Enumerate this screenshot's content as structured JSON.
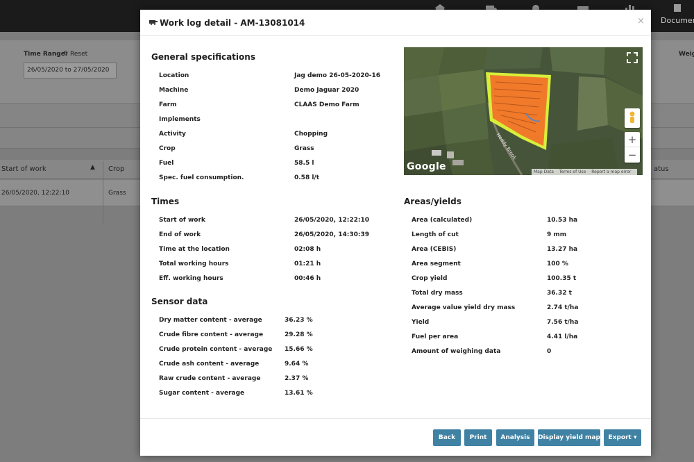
{
  "app": {
    "documents_label": "Document",
    "time_range_label": "Time Range:",
    "reset_label": "Reset",
    "date_range_value": "26/05/2020 to 27/05/2020",
    "weight_label": "Weig",
    "table": {
      "columns": {
        "start_of_work": "Start of work",
        "crop": "Crop",
        "status": "atus"
      },
      "row": {
        "start_of_work": "26/05/2020, 12:22:10",
        "crop": "Grass"
      }
    }
  },
  "modal": {
    "title": "Work log detail - AM-13081014",
    "close_label": "×",
    "general": {
      "heading": "General specifications",
      "rows": [
        {
          "label": "Location",
          "value": "Jag demo 26-05-2020-16"
        },
        {
          "label": "Machine",
          "value": "Demo Jaguar 2020"
        },
        {
          "label": "Farm",
          "value": "CLAAS Demo Farm"
        },
        {
          "label": "Implements",
          "value": ""
        },
        {
          "label": "Activity",
          "value": "Chopping"
        },
        {
          "label": "Crop",
          "value": "Grass"
        },
        {
          "label": "Fuel",
          "value": "58.5 l"
        },
        {
          "label": "Spec. fuel consumption.",
          "value": "0.58 l/t"
        }
      ]
    },
    "times": {
      "heading": "Times",
      "rows": [
        {
          "label": "Start of work",
          "value": "26/05/2020, 12:22:10"
        },
        {
          "label": "End of work",
          "value": "26/05/2020, 14:30:39"
        },
        {
          "label": "Time at the location",
          "value": "02:08 h"
        },
        {
          "label": "Total working hours",
          "value": "01:21 h"
        },
        {
          "label": "Eff. working hours",
          "value": "00:46 h"
        }
      ]
    },
    "sensor": {
      "heading": "Sensor data",
      "rows": [
        {
          "label": "Dry matter content - average",
          "value": "36.23 %"
        },
        {
          "label": "Crude fibre content - average",
          "value": "29.28 %"
        },
        {
          "label": "Crude protein content - average",
          "value": "15.66 %"
        },
        {
          "label": "Crude ash content - average",
          "value": "9.64 %"
        },
        {
          "label": "Raw crude content - average",
          "value": "2.37 %"
        },
        {
          "label": "Sugar content - average",
          "value": "13.61 %"
        }
      ]
    },
    "areas": {
      "heading": "Areas/yields",
      "rows": [
        {
          "label": "Area (calculated)",
          "value": "10.53 ha"
        },
        {
          "label": "Length of cut",
          "value": "9 mm"
        },
        {
          "label": "Area (CEBIS)",
          "value": "13.27 ha"
        },
        {
          "label": "Area segment",
          "value": "100 %"
        },
        {
          "label": "Crop yield",
          "value": "100.35 t"
        },
        {
          "label": "Total dry mass",
          "value": "36.32 t"
        },
        {
          "label": "Average value yield dry mass",
          "value": "2.74 t/ha"
        },
        {
          "label": "Yield",
          "value": "7.56 t/ha"
        },
        {
          "label": "Fuel per area",
          "value": "4.41 l/ha"
        },
        {
          "label": "Amount of weighing data",
          "value": "0"
        }
      ]
    },
    "map": {
      "logo": "Google",
      "road_label": "Heddy Brook",
      "footer": [
        "Map Data",
        "Terms of Use",
        "Report a map error"
      ],
      "zoom_in": "+",
      "zoom_out": "−",
      "field_color": "#f07a2a",
      "boundary_color": "#d7ef3a"
    },
    "buttons": {
      "back": "Back",
      "print": "Print",
      "analysis": "Analysis",
      "display_yield_map": "Display yield map",
      "export": "Export ▾"
    },
    "colors": {
      "button": "#3f82a3",
      "overlay": "#7d7d7d"
    }
  }
}
